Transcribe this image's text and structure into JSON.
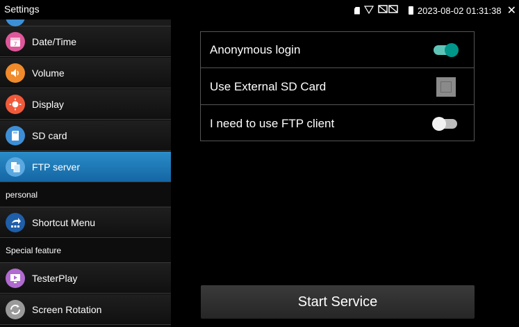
{
  "statusbar": {
    "title": "Settings",
    "datetime": "2023-08-02 01:31:38",
    "close_icon": "close-icon"
  },
  "sidebar": {
    "items": [
      {
        "label": "Date/Time",
        "icon": "calendar-icon",
        "color": "#e0569a",
        "active": false
      },
      {
        "label": "Volume",
        "icon": "speaker-icon",
        "color": "#f08a2b",
        "active": false
      },
      {
        "label": "Display",
        "icon": "brightness-icon",
        "color": "#f05a3a",
        "active": false
      },
      {
        "label": "SD card",
        "icon": "sd-card-icon",
        "color": "#3c8fd6",
        "active": false
      },
      {
        "label": "FTP server",
        "icon": "ftp-server-icon",
        "color": "#5aa8e0",
        "active": true
      }
    ],
    "section_personal": "personal",
    "personal_items": [
      {
        "label": "Shortcut Menu",
        "icon": "shortcut-icon",
        "color": "#1f5ea8"
      }
    ],
    "section_special": "Special feature",
    "special_items": [
      {
        "label": "TesterPlay",
        "icon": "play-icon",
        "color": "#b06ad0"
      },
      {
        "label": "Screen Rotation",
        "icon": "rotation-icon",
        "color": "#9a9a9a"
      }
    ]
  },
  "ftp": {
    "anonymous_login": {
      "label": "Anonymous login",
      "state": "on"
    },
    "external_sd": {
      "label": "Use External SD Card",
      "checked": false
    },
    "ftp_client": {
      "label": "I need to use FTP client",
      "state": "off"
    },
    "start_button": "Start Service"
  },
  "colors": {
    "accent_active": "#2a8cc8",
    "toggle_on": "#00968a"
  }
}
